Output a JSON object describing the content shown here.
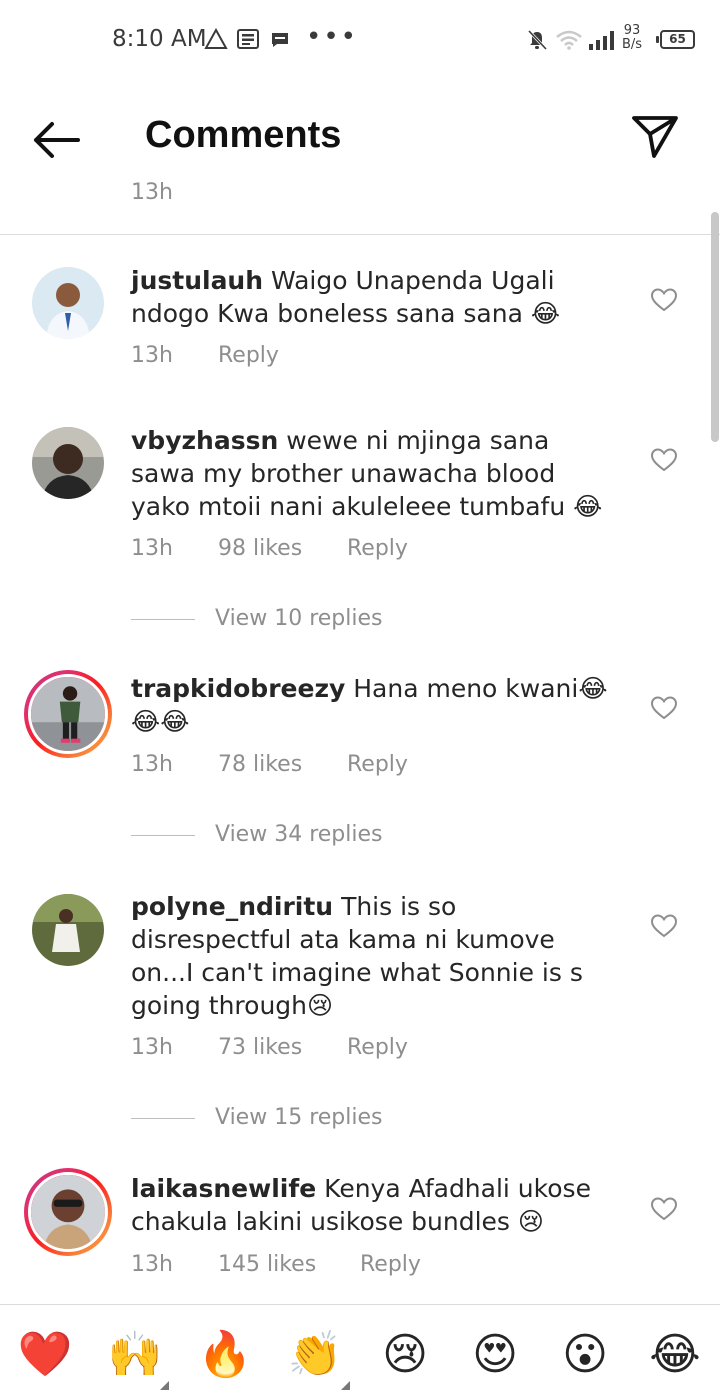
{
  "status_bar": {
    "time": "8:10 AM",
    "net_speed_value": "93",
    "net_speed_unit": "B/s",
    "battery": "65",
    "icons": [
      "warning-icon",
      "news-icon",
      "message-icon",
      "more-dots-icon",
      "mute-icon",
      "wifi-icon",
      "signal-icon",
      "battery-icon"
    ]
  },
  "header": {
    "title": "Comments",
    "back_icon": "arrow-left-icon",
    "send_icon": "send-icon"
  },
  "clipped_previous_time": "13h",
  "comments": [
    {
      "username": "justulauh",
      "text": "Waigo Unapenda Ugali ndogo Kwa boneless sana sana 😂",
      "time": "13h",
      "likes": "",
      "reply_label": "Reply",
      "has_story_ring": false
    },
    {
      "username": "vbyzhassn",
      "text": "wewe ni mjinga  sana sawa my brother unawacha blood yako mtoii nani akuleleee tumbafu 😂",
      "time": "13h",
      "likes": "98 likes",
      "reply_label": "Reply",
      "view_replies": "View 10 replies",
      "has_story_ring": false
    },
    {
      "username": "trapkidobreezy",
      "text": "Hana meno kwani😂😂😂",
      "time": "13h",
      "likes": "78 likes",
      "reply_label": "Reply",
      "view_replies": "View 34 replies",
      "has_story_ring": true
    },
    {
      "username": "polyne_ndiritu",
      "text": "This is so disrespectful ata kama ni  kumove on...I can't imagine what Sonnie is s going through😢",
      "time": "13h",
      "likes": "73 likes",
      "reply_label": "Reply",
      "view_replies": "View 15 replies",
      "has_story_ring": false
    },
    {
      "username": "laikasnewlife",
      "text": "Kenya Afadhali ukose chakula lakini usikose bundles 😢",
      "time": "13h",
      "likes": "145 likes",
      "reply_label": "Reply",
      "has_story_ring": true
    }
  ],
  "emoji_bar": [
    "❤️",
    "🙌",
    "🔥",
    "👏",
    "😢",
    "😍",
    "😮",
    "😂"
  ],
  "colors": {
    "text": "#262626",
    "secondary": "#8e8e8e",
    "divider": "#dbdbdb"
  }
}
